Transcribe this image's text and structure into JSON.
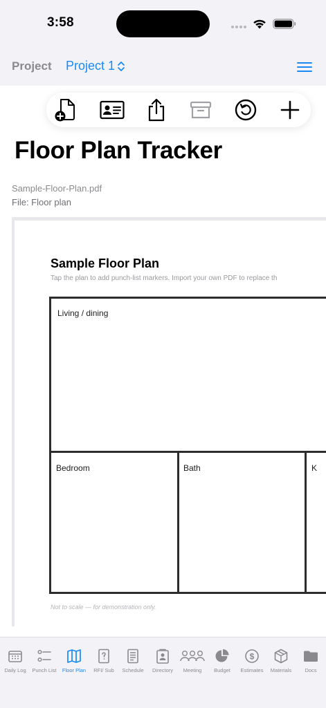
{
  "status": {
    "time": "3:58"
  },
  "nav": {
    "project_label": "Project",
    "project_name": "Project 1"
  },
  "toolbar": {
    "buttons": [
      {
        "icon": "add-file-icon"
      },
      {
        "icon": "contact-card-icon"
      },
      {
        "icon": "share-icon"
      },
      {
        "icon": "archive-icon"
      },
      {
        "icon": "history-icon"
      },
      {
        "icon": "plus-icon"
      }
    ]
  },
  "page": {
    "title": "Floor Plan Tracker",
    "file_name": "Sample-Floor-Plan.pdf",
    "file_label": "File: Floor plan"
  },
  "plan": {
    "title": "Sample Floor Plan",
    "subtitle": "Tap the plan to add punch-list markers. Import your own PDF to replace th",
    "rooms": {
      "living": "Living / dining",
      "bedroom": "Bedroom",
      "bath": "Bath",
      "kitchen_partial": "K"
    },
    "footnote": "Not to scale — for demonstration only."
  },
  "tabs": [
    {
      "label": "Daily Log",
      "icon": "daily-log-icon"
    },
    {
      "label": "Punch List",
      "icon": "punch-list-icon"
    },
    {
      "label": "Floor Plan",
      "icon": "floor-plan-icon",
      "active": true
    },
    {
      "label": "RFI/ Sub",
      "icon": "rfi-icon"
    },
    {
      "label": "Schedule",
      "icon": "schedule-icon"
    },
    {
      "label": "Directory",
      "icon": "directory-icon"
    },
    {
      "label": "Meeting",
      "icon": "meeting-icon"
    },
    {
      "label": "Budget",
      "icon": "budget-icon"
    },
    {
      "label": "Estimates",
      "icon": "estimates-icon"
    },
    {
      "label": "Materials",
      "icon": "materials-icon"
    },
    {
      "label": "Docs",
      "icon": "docs-icon"
    }
  ],
  "colors": {
    "accent": "#1a8af2",
    "background": "#f2f2f7",
    "disabled": "#a0a0a5"
  }
}
